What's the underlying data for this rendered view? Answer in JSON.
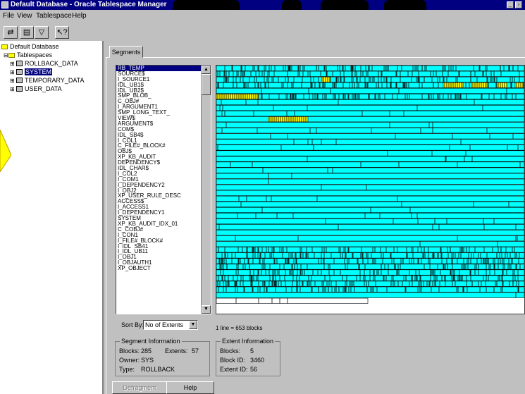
{
  "window": {
    "title": "Default Database - Oracle Tablespace Manager",
    "min_icon": "minimize-icon",
    "max_icon": "maximize-icon"
  },
  "menu": [
    "File",
    "View",
    "Tablespace",
    "Help"
  ],
  "toolbar_icons": [
    "refresh-icon",
    "database-icon",
    "filter-icon",
    "help-pointer-icon"
  ],
  "tree": {
    "root": "Default Database",
    "tablespaces": "Tablespaces",
    "items": [
      "ROLLBACK_DATA",
      "SYSTEM",
      "TEMPORARY_DATA",
      "USER_DATA"
    ],
    "selected": "SYSTEM"
  },
  "tab": "Segments",
  "segments": [
    "RB_TEMP",
    "SOURCE$",
    "I_SOURCE1",
    "IDL_UB1$",
    "IDL_UB2$",
    "SMP_BLOB_",
    "C_OBJ#",
    "I_ARGUMENT1",
    "SMP_LONG_TEXT_",
    "VIEW$",
    "ARGUMENT$",
    "COM$",
    "IDL_SB4$",
    "I_COL1",
    "C_FILE#_BLOCK#",
    "OBJ$",
    "XP_KB_AUDIT",
    "DEPENDENCY$",
    "IDL_CHAR$",
    "I_COL2",
    "I_COM1",
    "I_DEPENDENCY2",
    "I_OBJ2",
    "XP_USER_RULE_DESC",
    "ACCESS$",
    "I_ACCESS1",
    "I_DEPENDENCY1",
    "SYSTEM",
    "XP_KB_AUDIT_IDX_01",
    "C_COBJ#",
    "I_CON1",
    "I_FILE#_BLOCK#",
    "I_IDL_SB41",
    "I_IDL_UB11",
    "I_OBJ1",
    "I_OBJAUTH1",
    "XP_OBJECT"
  ],
  "selected_segment": "RB_TEMP",
  "sort": {
    "label": "Sort By:",
    "value": "No of Extents"
  },
  "scale_note": "1 line = 653 blocks",
  "segment_info": {
    "title": "Segment Information",
    "blocks_label": "Blocks:",
    "blocks": "285",
    "extents_label": "Extents:",
    "extents": "57",
    "owner_label": "Owner:",
    "owner": "SYS",
    "type_label": "Type:",
    "type": "ROLLBACK"
  },
  "extent_info": {
    "title": "Extent Information",
    "blocks_label": "Blocks:",
    "blocks": "5",
    "block_id_label": "Block ID:",
    "block_id": "3460",
    "extent_id_label": "Extent ID:",
    "extent_id": "56"
  },
  "buttons": {
    "defragment": "Defragment",
    "help": "Help"
  },
  "colors": {
    "extent": "#00ffff",
    "selected_extent": "#ffff00",
    "title_bar": "#000080",
    "face": "#c0c0c0"
  }
}
